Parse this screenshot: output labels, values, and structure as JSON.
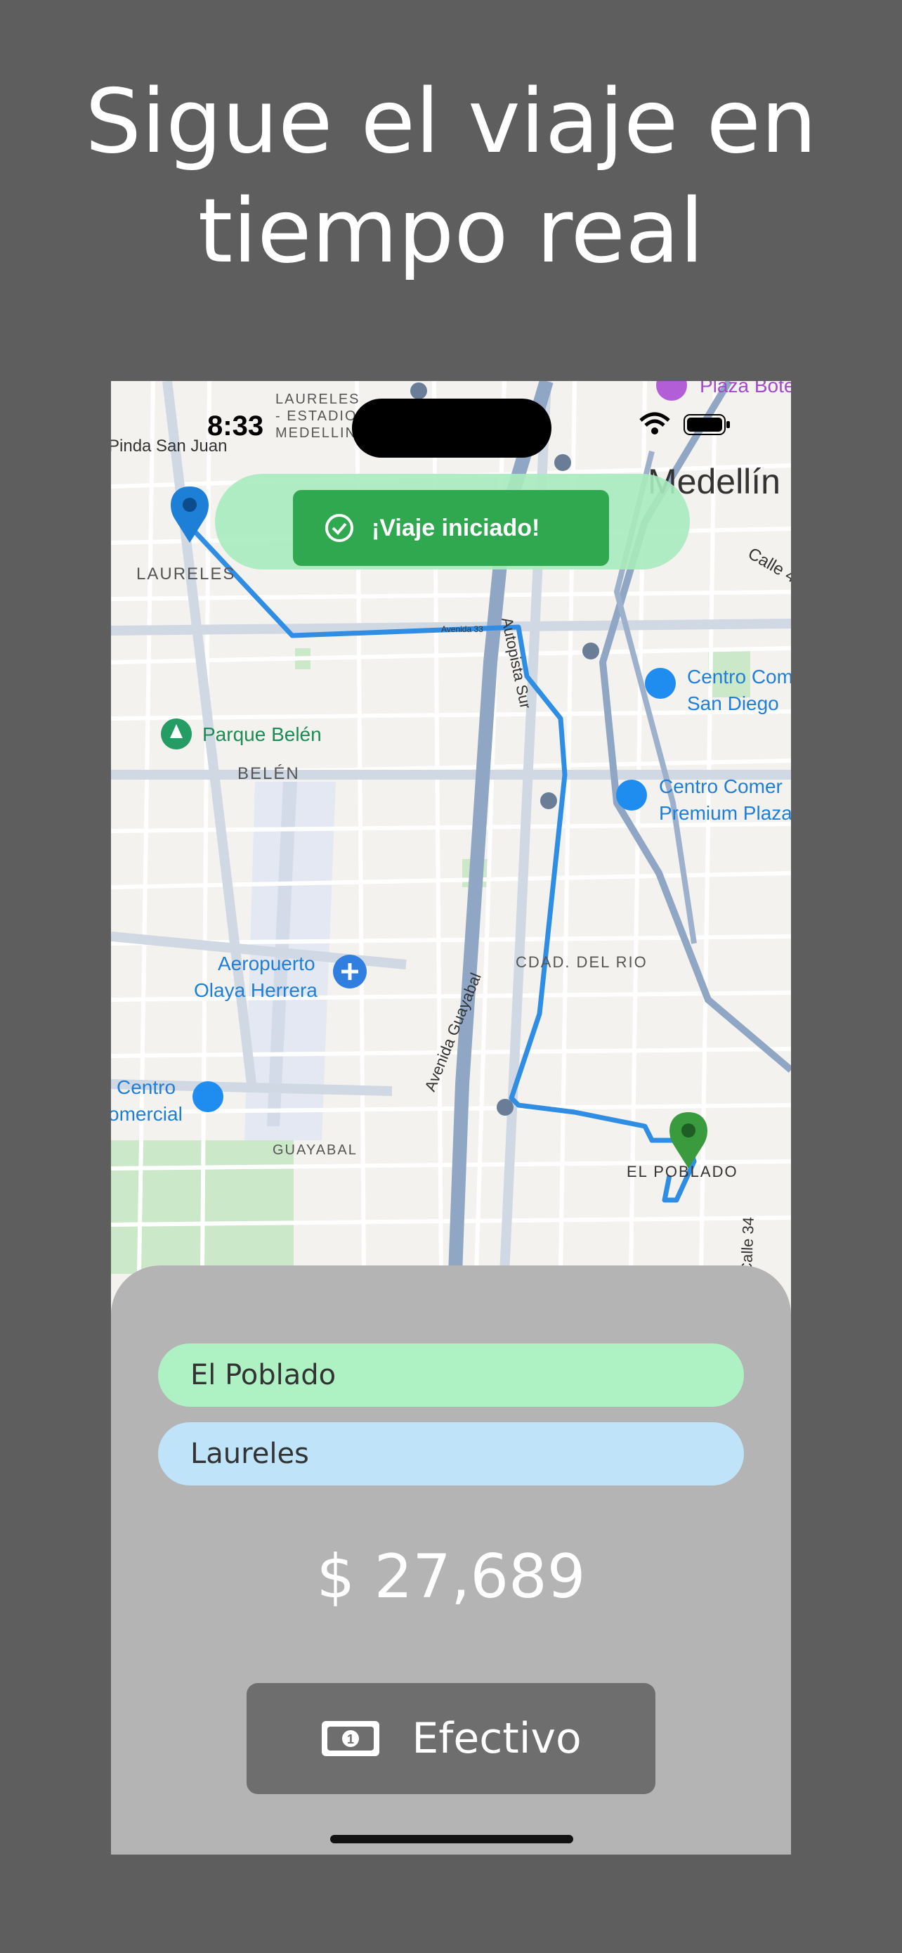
{
  "headline": {
    "line1": "Sigue el viaje en",
    "line2": "tiempo real"
  },
  "status_bar": {
    "time": "8:33"
  },
  "toast": {
    "message": "¡Viaje iniciado!"
  },
  "map": {
    "labels": {
      "laureles_estadio": [
        "LAURELES",
        "- ESTADIO",
        "MEDELLIN"
      ],
      "plaza_botero": "Plaza Botero",
      "medellin": "Medellín",
      "calle": "Calle 4",
      "pinda_san_juan": "Pinda San Juan",
      "laureles": "LAURELES",
      "avenida_33": "Avenida 33",
      "autopista_sur": "Autopista Sur",
      "centro_san_diego": [
        "Centro Com",
        "San Diego"
      ],
      "parque_belen": "Parque Belén",
      "belen": "BELÉN",
      "centro_premium": [
        "Centro Comer",
        "Premium Plaza"
      ],
      "aeropuerto": [
        "Aeropuerto",
        "Olaya Herrera"
      ],
      "cdad_del_rio": "CDAD. DEL RIO",
      "avenida_guayabal": "Avenida Guayabal",
      "centro_comercial": [
        "Centro",
        "omercial"
      ],
      "guayabal": "GUAYABAL",
      "el_poblado": "EL POBLADO",
      "calle_34": "Calle 34"
    },
    "colors": {
      "route": "#2f8de4",
      "origin_pin": "#1d7fd6",
      "destination_pin": "#3a9a3e"
    }
  },
  "trip": {
    "origin": "El Poblado",
    "destination": "Laureles",
    "price": "$ 27,689",
    "payment_method": "Efectivo"
  },
  "icons": [
    "check-circle-icon",
    "wifi-icon",
    "battery-icon",
    "cash-icon",
    "pin-icon",
    "airport-icon",
    "park-icon",
    "shopping-bag-icon",
    "metro-icon"
  ]
}
